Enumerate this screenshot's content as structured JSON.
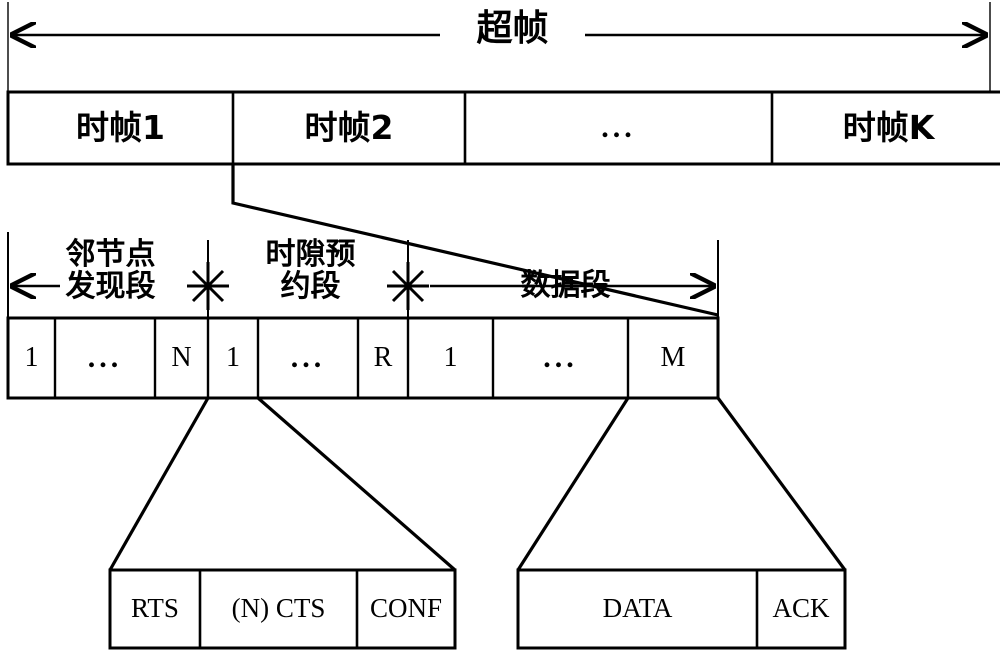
{
  "figure": {
    "title": "超帧",
    "title_meaning_icon": "superframe-span-arrow"
  },
  "superframe": {
    "label": "超帧",
    "span_arrow": {
      "left_arrow_icon": "arrow-left-icon",
      "right_arrow_icon": "arrow-right-icon"
    }
  },
  "timeframe_row": {
    "cells": [
      {
        "label": "时帧1"
      },
      {
        "label": "时帧2"
      },
      {
        "label": "..."
      },
      {
        "label": "时帧K"
      }
    ]
  },
  "segments": [
    {
      "label": "邻节点\n发现段"
    },
    {
      "label": "时隙预\n约段"
    },
    {
      "label": "数据段"
    }
  ],
  "segment_markers": {
    "left_end_icon": "arrow-left-icon",
    "boundary_icon": "asterisk-boundary-icon",
    "right_end_icon": "arrow-right-icon"
  },
  "slot_row": {
    "cells": [
      {
        "label": "1"
      },
      {
        "label": "..."
      },
      {
        "label": "N"
      },
      {
        "label": "1"
      },
      {
        "label": "..."
      },
      {
        "label": "R"
      },
      {
        "label": "1"
      },
      {
        "label": "..."
      },
      {
        "label": "M"
      }
    ]
  },
  "reservation_packet": {
    "fields": [
      {
        "label": "RTS"
      },
      {
        "label": "(N) CTS"
      },
      {
        "label": "CONF"
      }
    ]
  },
  "data_packet": {
    "fields": [
      {
        "label": "DATA"
      },
      {
        "label": "ACK"
      }
    ]
  },
  "style": {
    "stroke": "#000000",
    "background": "#ffffff"
  }
}
